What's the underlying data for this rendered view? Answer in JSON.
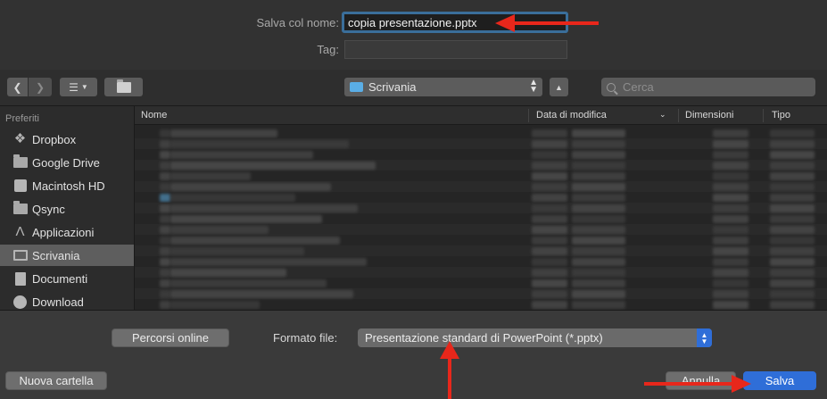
{
  "save_form": {
    "name_label": "Salva col nome:",
    "name_value": "copia presentazione.pptx",
    "tag_label": "Tag:",
    "tag_value": ""
  },
  "toolbar": {
    "location": "Scrivania",
    "search_placeholder": "Cerca"
  },
  "sidebar": {
    "title": "Preferiti",
    "items": [
      {
        "label": "Dropbox",
        "icon": "dropbox-icon"
      },
      {
        "label": "Google Drive",
        "icon": "folder-icon"
      },
      {
        "label": "Macintosh HD",
        "icon": "disk-icon"
      },
      {
        "label": "Qsync",
        "icon": "folder-icon"
      },
      {
        "label": "Applicazioni",
        "icon": "applications-icon"
      },
      {
        "label": "Scrivania",
        "icon": "desktop-icon",
        "selected": true
      },
      {
        "label": "Documenti",
        "icon": "document-icon"
      },
      {
        "label": "Download",
        "icon": "download-icon"
      }
    ]
  },
  "file_list": {
    "columns": [
      "Nome",
      "Data di modifica",
      "Dimensioni",
      "Tipo"
    ]
  },
  "bottom": {
    "online_button": "Percorsi online",
    "format_label": "Formato file:",
    "format_value": "Presentazione standard di PowerPoint (*.pptx)",
    "new_folder_button": "Nuova cartella",
    "cancel_button": "Annulla",
    "save_button": "Salva"
  },
  "colors": {
    "accent": "#2f6ed8",
    "annotation_arrow": "#e8271b"
  }
}
